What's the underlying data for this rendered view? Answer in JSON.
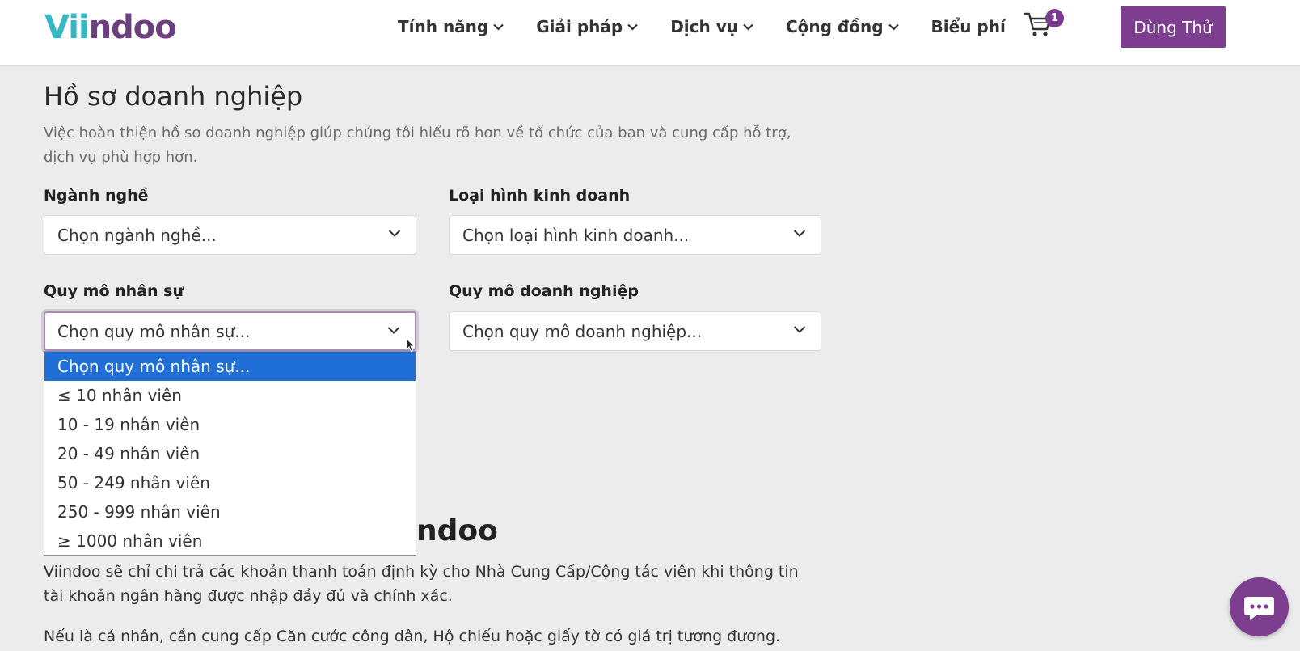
{
  "header": {
    "logo_part1": "Vii",
    "logo_part2": "ndoo",
    "nav": [
      {
        "label": "Tính năng",
        "has_dropdown": true
      },
      {
        "label": "Giải pháp",
        "has_dropdown": true
      },
      {
        "label": "Dịch vụ",
        "has_dropdown": true
      },
      {
        "label": "Cộng đồng",
        "has_dropdown": true
      },
      {
        "label": "Biểu phí",
        "has_dropdown": false
      }
    ],
    "cart_count": "1",
    "cta_label": "Dùng Thử"
  },
  "profile": {
    "title": "Hồ sơ doanh nghiệp",
    "description": "Việc hoàn thiện hồ sơ doanh nghiệp giúp chúng tôi hiểu rõ hơn về tổ chức của bạn và cung cấp hỗ trợ, dịch vụ phù hợp hơn.",
    "fields": {
      "industry": {
        "label": "Ngành nghề",
        "value": "Chọn ngành nghề..."
      },
      "business_type": {
        "label": "Loại hình kinh doanh",
        "value": "Chọn loại hình kinh doanh..."
      },
      "staff_size": {
        "label": "Quy mô nhân sự",
        "value": "Chọn quy mô nhân sự..."
      },
      "company_size": {
        "label": "Quy mô doanh nghiệp",
        "value": "Chọn quy mô doanh nghiệp..."
      }
    },
    "staff_size_options": [
      "Chọn quy mô nhân sự...",
      "≤ 10 nhân viên",
      "10 - 19 nhân viên",
      "20 - 49 nhân viên",
      "50 - 249 nhân viên",
      "250 - 999 nhân viên",
      "≥ 1000 nhân viên"
    ],
    "selected_option_index": 0
  },
  "payment": {
    "title_visible_fragment": "ndoo",
    "paragraph1": "Viindoo sẽ chỉ chi trả các khoản thanh toán định kỳ cho Nhà Cung Cấp/Cộng tác viên khi thông tin tài khoản ngân hàng được nhập đầy đủ và chính xác.",
    "paragraph2": "Nếu là cá nhân, cần cung cấp Căn cước công dân, Hộ chiếu hoặc giấy tờ có giá trị tương đương."
  },
  "colors": {
    "brand_purple": "#7d3e8f",
    "logo_teal": "#35b8c4",
    "selected_option": "#1f6fd6"
  },
  "icons": {
    "cart": "shopping-cart-icon",
    "chat": "chat-bubble-icon",
    "dropdown": "chevron-down-icon"
  }
}
